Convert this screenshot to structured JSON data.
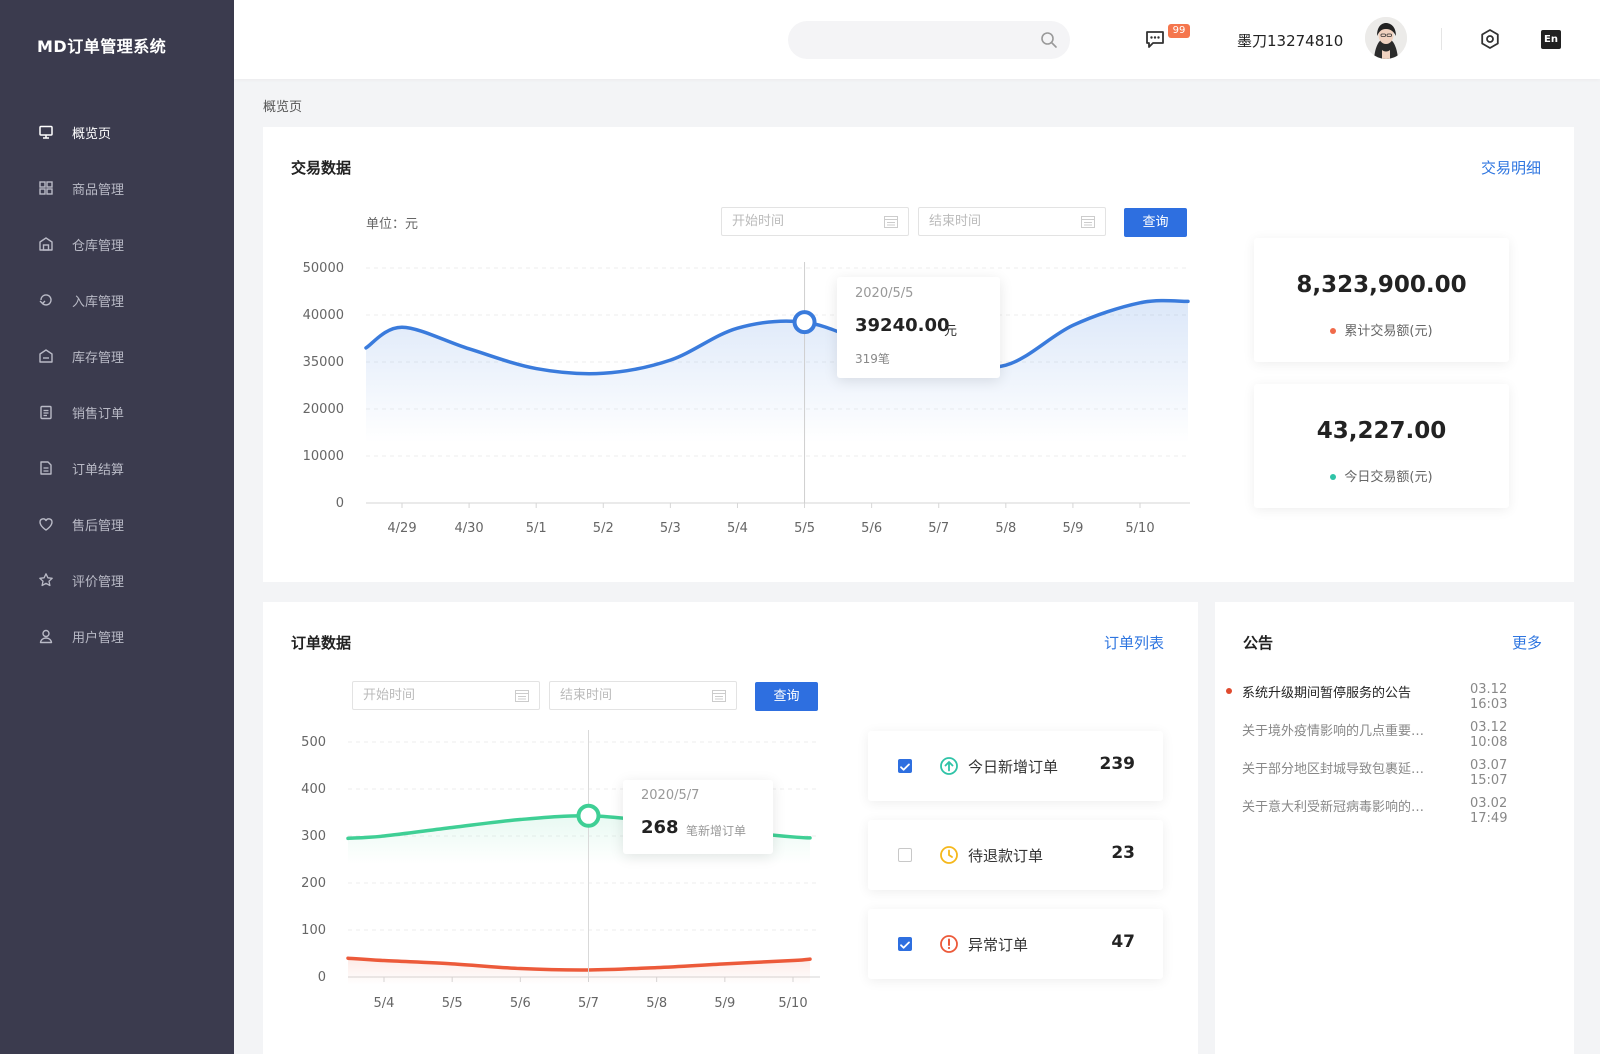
{
  "app": {
    "title": "MD订单管理系统"
  },
  "sidebar": {
    "items": [
      {
        "label": "概览页",
        "icon": "monitor-icon",
        "active": true
      },
      {
        "label": "商品管理",
        "icon": "grid-icon"
      },
      {
        "label": "仓库管理",
        "icon": "warehouse-icon"
      },
      {
        "label": "入库管理",
        "icon": "inbound-icon"
      },
      {
        "label": "库存管理",
        "icon": "inventory-icon"
      },
      {
        "label": "销售订单",
        "icon": "clipboard-icon"
      },
      {
        "label": "订单结算",
        "icon": "settlement-icon"
      },
      {
        "label": "售后管理",
        "icon": "heart-icon"
      },
      {
        "label": "评价管理",
        "icon": "star-icon"
      },
      {
        "label": "用户管理",
        "icon": "user-icon"
      }
    ]
  },
  "header": {
    "search_placeholder": "",
    "message_badge": "99",
    "username": "墨刀13274810",
    "lang": "En"
  },
  "breadcrumb": "概览页",
  "transaction": {
    "title": "交易数据",
    "link": "交易明细",
    "unit": "单位：元",
    "start_placeholder": "开始时间",
    "end_placeholder": "结束时间",
    "query": "查询",
    "tooltip": {
      "date": "2020/5/5",
      "value": "39240.00",
      "unit": "元",
      "count": "319笔"
    },
    "stats": [
      {
        "value": "8,323,900.00",
        "label": "累计交易额(元)",
        "color": "#f06a4a"
      },
      {
        "value": "43,227.00",
        "label": "今日交易额(元)",
        "color": "#2fc3a7"
      }
    ]
  },
  "orders": {
    "title": "订单数据",
    "link": "订单列表",
    "start_placeholder": "开始时间",
    "end_placeholder": "结束时间",
    "query": "查询",
    "tooltip": {
      "date": "2020/5/7",
      "value": "268",
      "unit": "笔新增订单"
    },
    "rows": [
      {
        "label": "今日新增订单",
        "count": "239",
        "checked": true,
        "icon": "arrow-up-circle-icon",
        "color": "#2fc3a7"
      },
      {
        "label": "待退款订单",
        "count": "23",
        "checked": false,
        "icon": "clock-icon",
        "color": "#f5b81c"
      },
      {
        "label": "异常订单",
        "count": "47",
        "checked": true,
        "icon": "alert-circle-icon",
        "color": "#ec5a3a"
      }
    ]
  },
  "notices": {
    "title": "公告",
    "more": "更多",
    "items": [
      {
        "title": "系统升级期间暂停服务的公告",
        "time": "03.12 16:03"
      },
      {
        "title": "关于境外疫情影响的几点重要通知",
        "time": "03.12 10:08"
      },
      {
        "title": "关于部分地区封城导致包裹延迟的说明",
        "time": "03.07 15:07"
      },
      {
        "title": "关于意大利受新冠病毒影响的通知",
        "time": "03.02 17:49"
      }
    ]
  },
  "chart_data": [
    {
      "type": "area",
      "title": "交易数据",
      "ylabel": "单位：元",
      "categories": [
        "4/29",
        "4/30",
        "5/1",
        "5/2",
        "5/3",
        "5/4",
        "5/5",
        "5/6",
        "5/7",
        "5/8",
        "5/9",
        "5/10"
      ],
      "y_ticks": [
        0,
        10000,
        20000,
        35000,
        40000,
        50000
      ],
      "series": [
        {
          "values": [
            38700,
            36400,
            32900,
            31400,
            35200,
            38600,
            39240,
            36900,
            35100,
            34000,
            38900,
            42600
          ],
          "color": "#3a7bdc"
        }
      ],
      "grid": true
    },
    {
      "type": "line",
      "title": "订单数据",
      "categories": [
        "5/4",
        "5/5",
        "5/6",
        "5/7",
        "5/8",
        "5/9",
        "5/10"
      ],
      "y_ticks": [
        0,
        100,
        200,
        300,
        400,
        500
      ],
      "ylim": [
        0,
        500
      ],
      "series": [
        {
          "values": [
            300,
            318,
            335,
            343,
            330,
            312,
            298
          ],
          "color": "#3fcf95"
        },
        {
          "values": [
            35,
            28,
            18,
            15,
            20,
            28,
            35
          ],
          "color": "#ec5a3a"
        }
      ],
      "grid": true
    }
  ]
}
